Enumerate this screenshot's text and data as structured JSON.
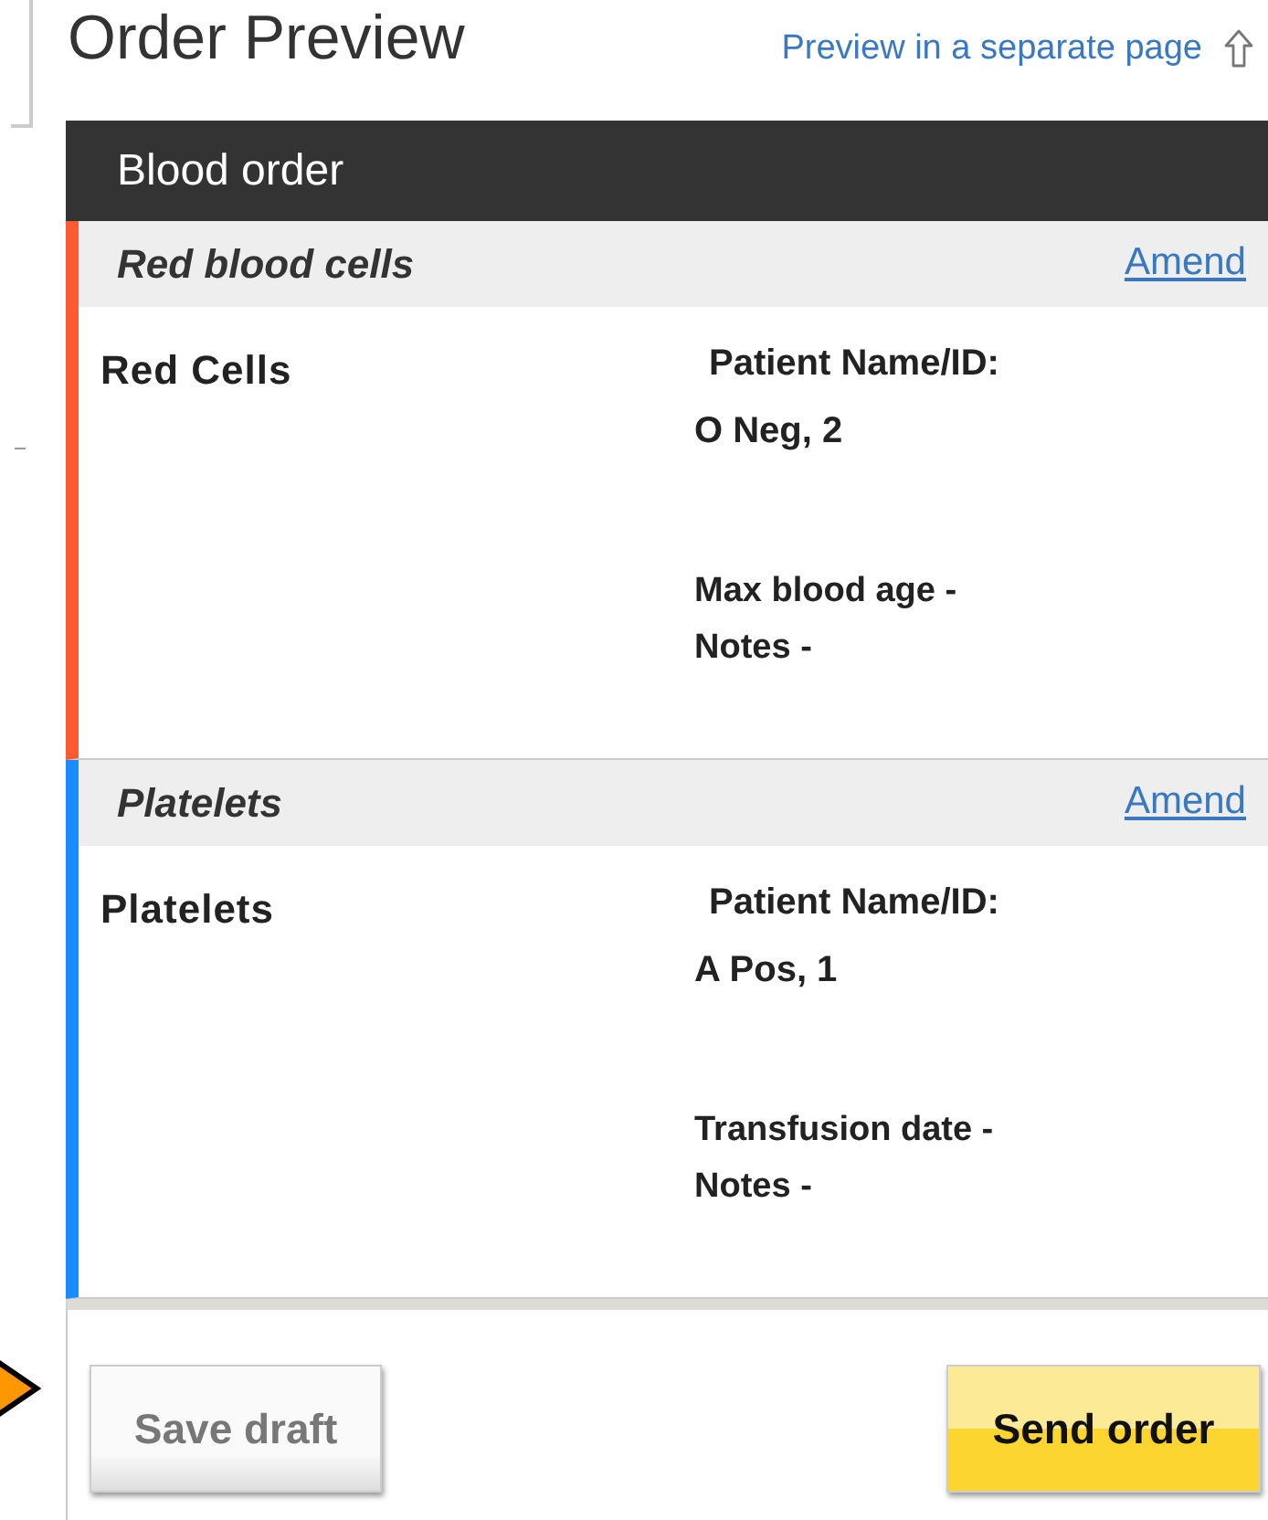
{
  "title": "Order Preview",
  "preview_link": "Preview in a separate page",
  "panel": {
    "title": "Blood order",
    "sections": [
      {
        "heading": "Red blood cells",
        "amend": "Amend",
        "color": "#ff5a30",
        "product": "Red Cells",
        "patient_label": "Patient Name/ID:",
        "patient_value": "O Neg, 2",
        "details": [
          "Max blood age -",
          "Notes -"
        ]
      },
      {
        "heading": "Platelets",
        "amend": "Amend",
        "color": "#1a8cff",
        "product": "Platelets",
        "patient_label": "Patient Name/ID:",
        "patient_value": "A Pos, 1",
        "details": [
          "Transfusion date -",
          "Notes -"
        ]
      }
    ]
  },
  "buttons": [
    {
      "label": "Save draft",
      "kind": "secondary"
    },
    {
      "label": "Send order",
      "kind": "primary"
    }
  ]
}
